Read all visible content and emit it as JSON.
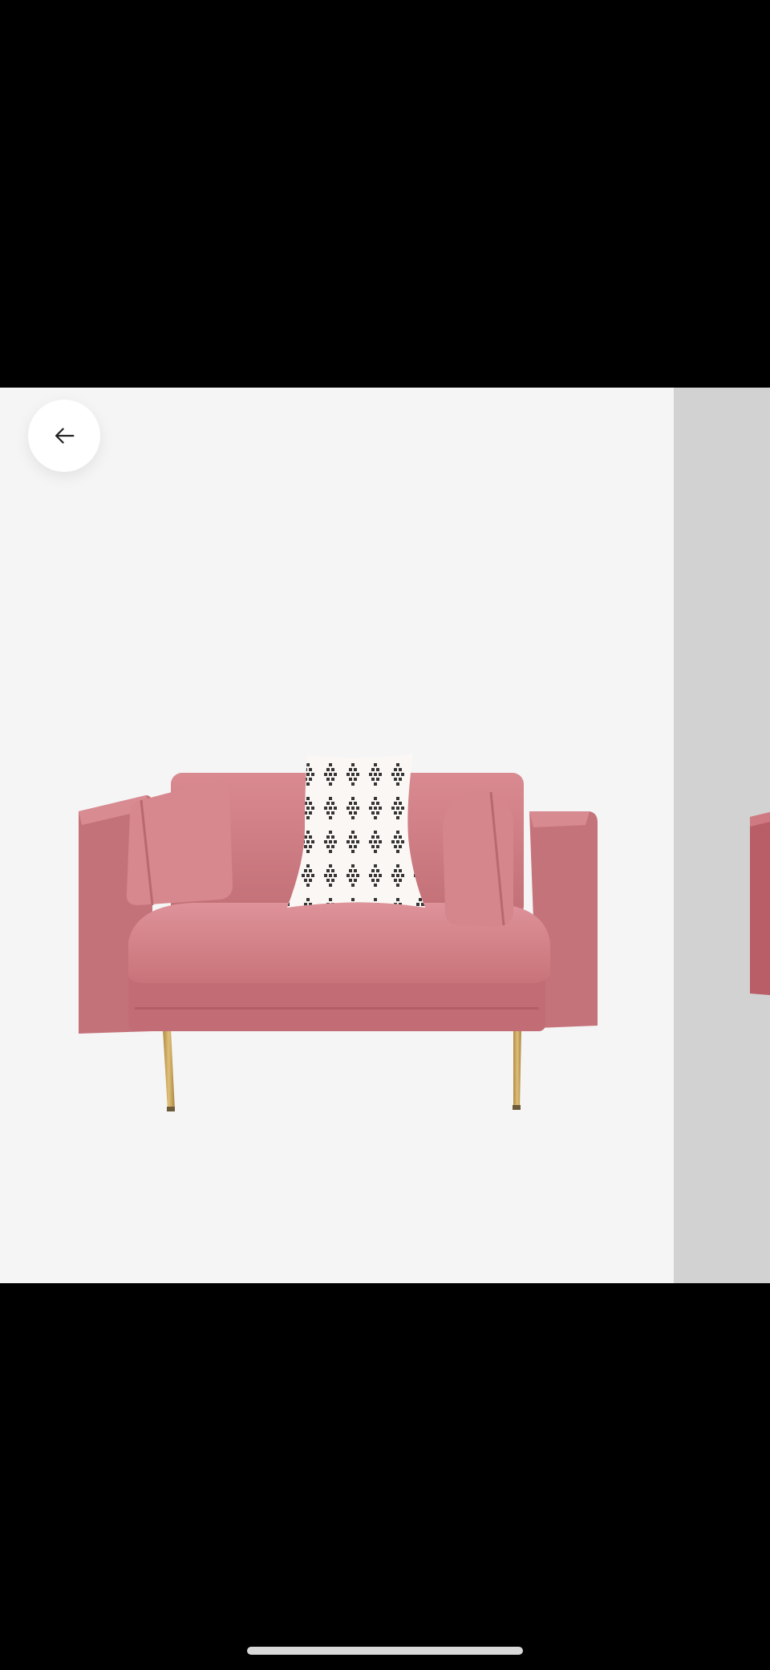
{
  "viewer": {
    "back_button": {
      "icon": "arrow-left-icon",
      "aria_label": "Back"
    },
    "slides": [
      {
        "alt": "Pink velvet armchair with patterned cushion",
        "colors": {
          "background": "#f5f5f5",
          "velvet": "#cc7a80",
          "legs": "#c9a55c",
          "pillow": "#fbf7f4",
          "pillow_pattern": "#2b2b2b"
        }
      },
      {
        "alt": "Next product image",
        "colors": {
          "background": "#d2d2d2"
        }
      }
    ]
  },
  "colors": {
    "screen_background": "#000000",
    "home_indicator": "#d8d8d8"
  }
}
